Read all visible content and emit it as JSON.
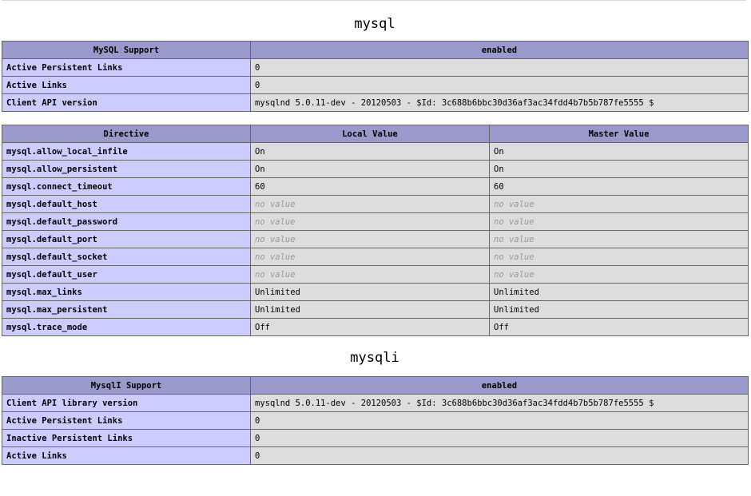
{
  "mysql": {
    "title": "mysql",
    "support": {
      "headers": [
        "MySQL Support",
        "enabled"
      ],
      "rows": [
        {
          "name": "Active Persistent Links",
          "value": "0"
        },
        {
          "name": "Active Links",
          "value": "0"
        },
        {
          "name": "Client API version",
          "value": "mysqlnd 5.0.11-dev - 20120503 - $Id: 3c688b6bbc30d36af3ac34fdd4b7b5b787fe5555 $"
        }
      ]
    },
    "directives": {
      "headers": [
        "Directive",
        "Local Value",
        "Master Value"
      ],
      "rows": [
        {
          "name": "mysql.allow_local_infile",
          "local": "On",
          "master": "On",
          "novalue": false
        },
        {
          "name": "mysql.allow_persistent",
          "local": "On",
          "master": "On",
          "novalue": false
        },
        {
          "name": "mysql.connect_timeout",
          "local": "60",
          "master": "60",
          "novalue": false
        },
        {
          "name": "mysql.default_host",
          "local": "no value",
          "master": "no value",
          "novalue": true
        },
        {
          "name": "mysql.default_password",
          "local": "no value",
          "master": "no value",
          "novalue": true
        },
        {
          "name": "mysql.default_port",
          "local": "no value",
          "master": "no value",
          "novalue": true
        },
        {
          "name": "mysql.default_socket",
          "local": "no value",
          "master": "no value",
          "novalue": true
        },
        {
          "name": "mysql.default_user",
          "local": "no value",
          "master": "no value",
          "novalue": true
        },
        {
          "name": "mysql.max_links",
          "local": "Unlimited",
          "master": "Unlimited",
          "novalue": false
        },
        {
          "name": "mysql.max_persistent",
          "local": "Unlimited",
          "master": "Unlimited",
          "novalue": false
        },
        {
          "name": "mysql.trace_mode",
          "local": "Off",
          "master": "Off",
          "novalue": false
        }
      ]
    }
  },
  "mysqli": {
    "title": "mysqli",
    "support": {
      "headers": [
        "MysqlI Support",
        "enabled"
      ],
      "rows": [
        {
          "name": "Client API library version",
          "value": "mysqlnd 5.0.11-dev - 20120503 - $Id: 3c688b6bbc30d36af3ac34fdd4b7b5b787fe5555 $"
        },
        {
          "name": "Active Persistent Links",
          "value": "0"
        },
        {
          "name": "Inactive Persistent Links",
          "value": "0"
        },
        {
          "name": "Active Links",
          "value": "0"
        }
      ]
    }
  },
  "colors": {
    "header_bg": "#9999cc",
    "name_bg": "#ccccff",
    "value_bg": "#dddddd",
    "novalue_text": "#999999"
  }
}
